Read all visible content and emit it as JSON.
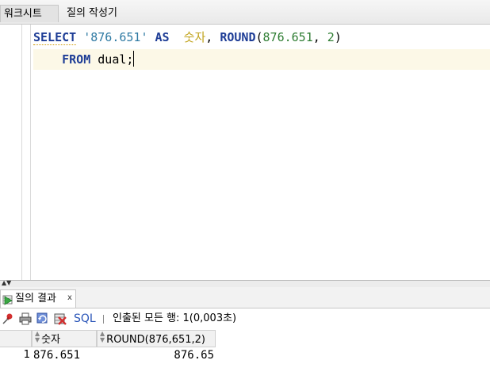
{
  "tabs": {
    "worksheet": "워크시트",
    "query_builder": "질의 작성기"
  },
  "editor": {
    "line1": {
      "select_kw": "SELECT",
      "literal": "'876.651'",
      "as_kw": "AS",
      "alias": "숫자",
      "comma1": ",",
      "round_fn": "ROUND",
      "open_paren": "(",
      "arg1": "876.651",
      "comma2": ",",
      "arg2": "2",
      "close_paren": ")"
    },
    "line2": {
      "from_kw": "FROM",
      "table": "dual;"
    }
  },
  "result_panel": {
    "tab_label": "질의 결과",
    "close_label": "x",
    "sql_link": "SQL",
    "status": "인출된 모든 행: 1(0,003초)"
  },
  "grid": {
    "columns": [
      "숫자",
      "ROUND(876,651,2)"
    ],
    "rows": [
      {
        "row_number": "1",
        "cells": [
          "876.651",
          "876.65"
        ]
      }
    ]
  },
  "colors": {
    "keyword": "#1e3d96",
    "string": "#2f7aa3",
    "alias": "#c1a31c",
    "number": "#2e7d32",
    "current_line": "#fcf8e7",
    "sql_link": "#2a55b8"
  },
  "icons": {
    "result_tab": "play-results-icon",
    "toolbar": [
      "pin-icon",
      "print-icon",
      "refresh-icon",
      "delete-icon"
    ],
    "sort": "sort-arrows-icon",
    "splitter": "collapse-arrows-icon"
  }
}
